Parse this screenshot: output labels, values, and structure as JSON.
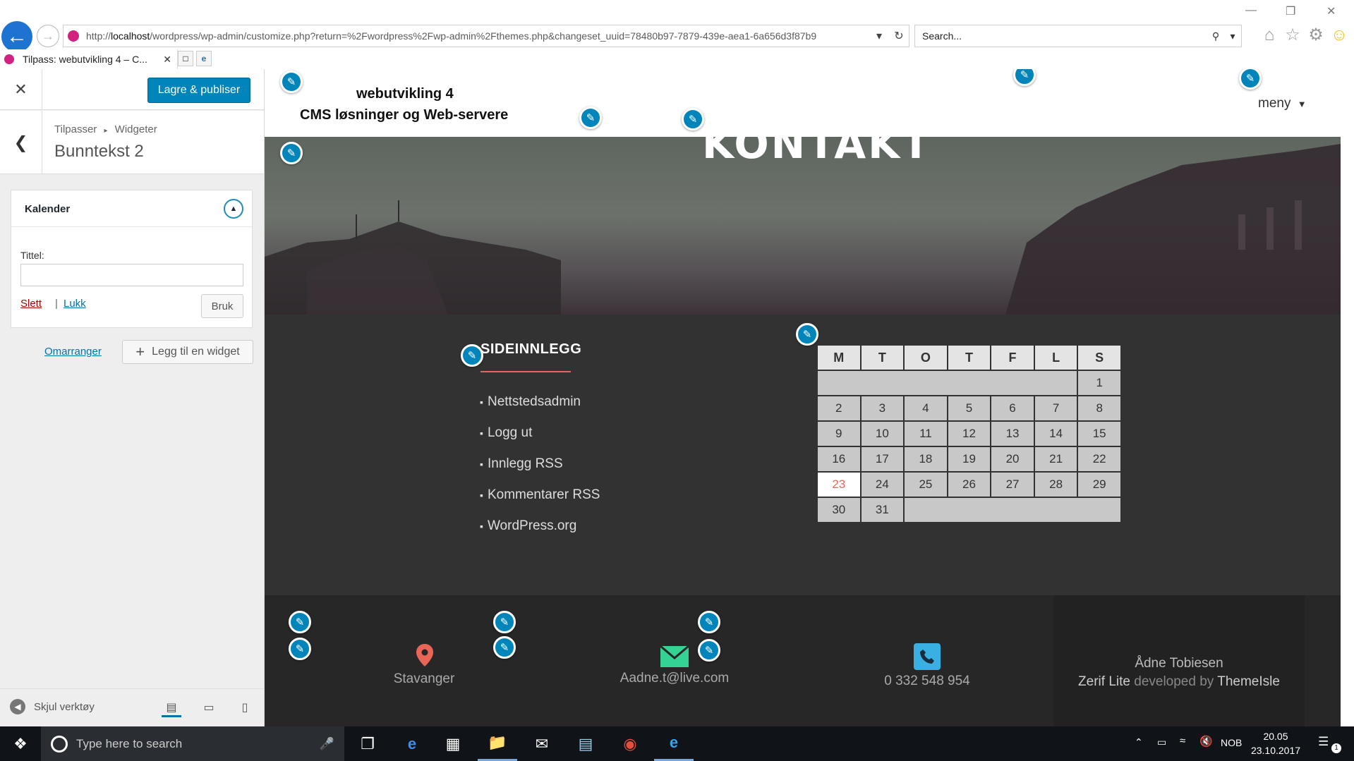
{
  "browser": {
    "url_prefix": "http://",
    "url_host": "localhost",
    "url_rest": "/wordpress/wp-admin/customize.php?return=%2Fwordpress%2Fwp-admin%2Fthemes.php&changeset_uuid=78480b97-7879-439e-aea1-6a656d3f87b9",
    "search_placeholder": "Search...",
    "tab_title": "Tilpass: webutvikling 4 – C...",
    "icons": [
      "back-arrow-icon",
      "forward-arrow-icon",
      "refresh-icon",
      "search-icon",
      "home-icon",
      "star-icon",
      "gear-icon",
      "smiley-icon"
    ]
  },
  "customizer": {
    "publish_label": "Lagre & publiser",
    "breadcrumb_root": "Tilpasser",
    "breadcrumb_sep": "▸",
    "breadcrumb_current": "Widgeter",
    "section_title": "Bunntekst 2",
    "widget": {
      "name": "Kalender",
      "title_label": "Tittel:",
      "title_value": "",
      "delete_label": "Slett",
      "separator": "|",
      "close_label": "Lukk",
      "apply_label": "Bruk"
    },
    "reorder_label": "Omarranger",
    "add_widget_label": "Legg til en widget",
    "hide_controls_label": "Skjul verktøy"
  },
  "site": {
    "name": "webutvikling 4",
    "description": "CMS løsninger og Web-servere",
    "menu_label": "meny",
    "page_title": "KONTAKT",
    "sidebar_title": "SIDEINNLEGG",
    "sidebar_links": [
      "Nettstedsadmin",
      "Logg ut",
      "Innlegg RSS",
      "Kommentarer RSS",
      "WordPress.org"
    ],
    "calendar": {
      "weekdays": [
        "M",
        "T",
        "O",
        "T",
        "F",
        "L",
        "S"
      ],
      "weeks": [
        [
          "",
          "",
          "",
          "",
          "",
          "",
          "1"
        ],
        [
          "2",
          "3",
          "4",
          "5",
          "6",
          "7",
          "8"
        ],
        [
          "9",
          "10",
          "11",
          "12",
          "13",
          "14",
          "15"
        ],
        [
          "16",
          "17",
          "18",
          "19",
          "20",
          "21",
          "22"
        ],
        [
          "23",
          "24",
          "25",
          "26",
          "27",
          "28",
          "29"
        ],
        [
          "30",
          "31",
          "",
          "",
          "",
          "",
          ""
        ]
      ],
      "today": "23"
    },
    "contact": {
      "location": "Stavanger",
      "email": "Aadne.t@live.com",
      "phone": "0 332 548 954"
    },
    "footer_author": "Ådne Tobiesen",
    "footer_theme": "Zerif Lite",
    "footer_developed_by": "developed by",
    "footer_company": "ThemeIsle",
    "colors": {
      "accent": "#e96656",
      "wp_blue": "#0085ba",
      "email_green": "#34d293",
      "phone_blue": "#3ab0e2"
    }
  },
  "taskbar": {
    "search_placeholder": "Type here to search",
    "language": "NOB",
    "time": "20.05",
    "date": "23.10.2017",
    "notification_count": "1"
  }
}
